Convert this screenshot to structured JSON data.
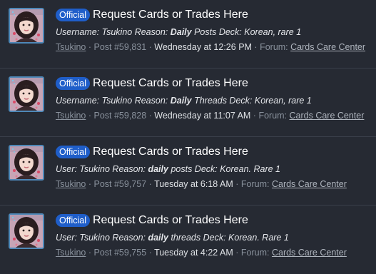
{
  "results": [
    {
      "badge": "Official",
      "title": "Request Cards or Trades Here",
      "snippet_pre": "Username: Tsukino Reason: ",
      "snippet_bold": "Daily",
      "snippet_post": " Posts Deck: Korean, rare 1",
      "author": "Tsukino",
      "post": "Post #59,831",
      "time": "Wednesday at 12:26 PM",
      "forum_label": "Forum:",
      "forum": "Cards Care Center"
    },
    {
      "badge": "Official",
      "title": "Request Cards or Trades Here",
      "snippet_pre": "Username: Tsukino Reason: ",
      "snippet_bold": "Daily",
      "snippet_post": " Threads Deck: Korean, rare 1",
      "author": "Tsukino",
      "post": "Post #59,828",
      "time": "Wednesday at 11:07 AM",
      "forum_label": "Forum:",
      "forum": "Cards Care Center"
    },
    {
      "badge": "Official",
      "title": "Request Cards or Trades Here",
      "snippet_pre": "User: Tsukino Reason: ",
      "snippet_bold": "daily",
      "snippet_post": " posts Deck: Korean. Rare 1",
      "author": "Tsukino",
      "post": "Post #59,757",
      "time": "Tuesday at 6:18 AM",
      "forum_label": "Forum:",
      "forum": "Cards Care Center"
    },
    {
      "badge": "Official",
      "title": "Request Cards or Trades Here",
      "snippet_pre": "User: Tsukino Reason: ",
      "snippet_bold": "daily",
      "snippet_post": " threads Deck: Korean. Rare 1",
      "author": "Tsukino",
      "post": "Post #59,755",
      "time": "Tuesday at 4:22 AM",
      "forum_label": "Forum:",
      "forum": "Cards Care Center"
    }
  ],
  "separator": " · ",
  "colors": {
    "background": "#262a33",
    "badge": "#1f5ec9",
    "avatar_border": "#4e88b8"
  }
}
